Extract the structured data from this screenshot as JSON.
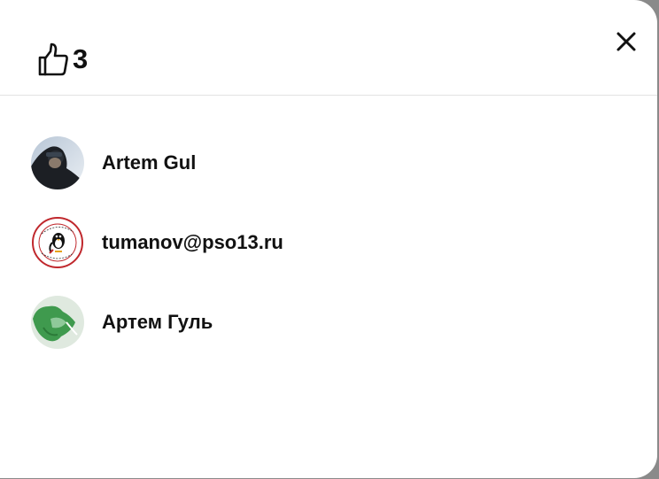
{
  "likes": {
    "count": "3",
    "icon": "thumbs-up-icon"
  },
  "close": {
    "icon": "close-icon"
  },
  "users": [
    {
      "name": "Artem Gul",
      "avatar": "photo-avatar"
    },
    {
      "name": "tumanov@pso13.ru",
      "avatar": "penguin-badge-avatar"
    },
    {
      "name": "Артем Гуль",
      "avatar": "green-shape-avatar"
    }
  ],
  "colors": {
    "background": "#ffffff",
    "text": "#111111",
    "divider": "#e2e2e2",
    "overlay": "#8a8a8a"
  }
}
